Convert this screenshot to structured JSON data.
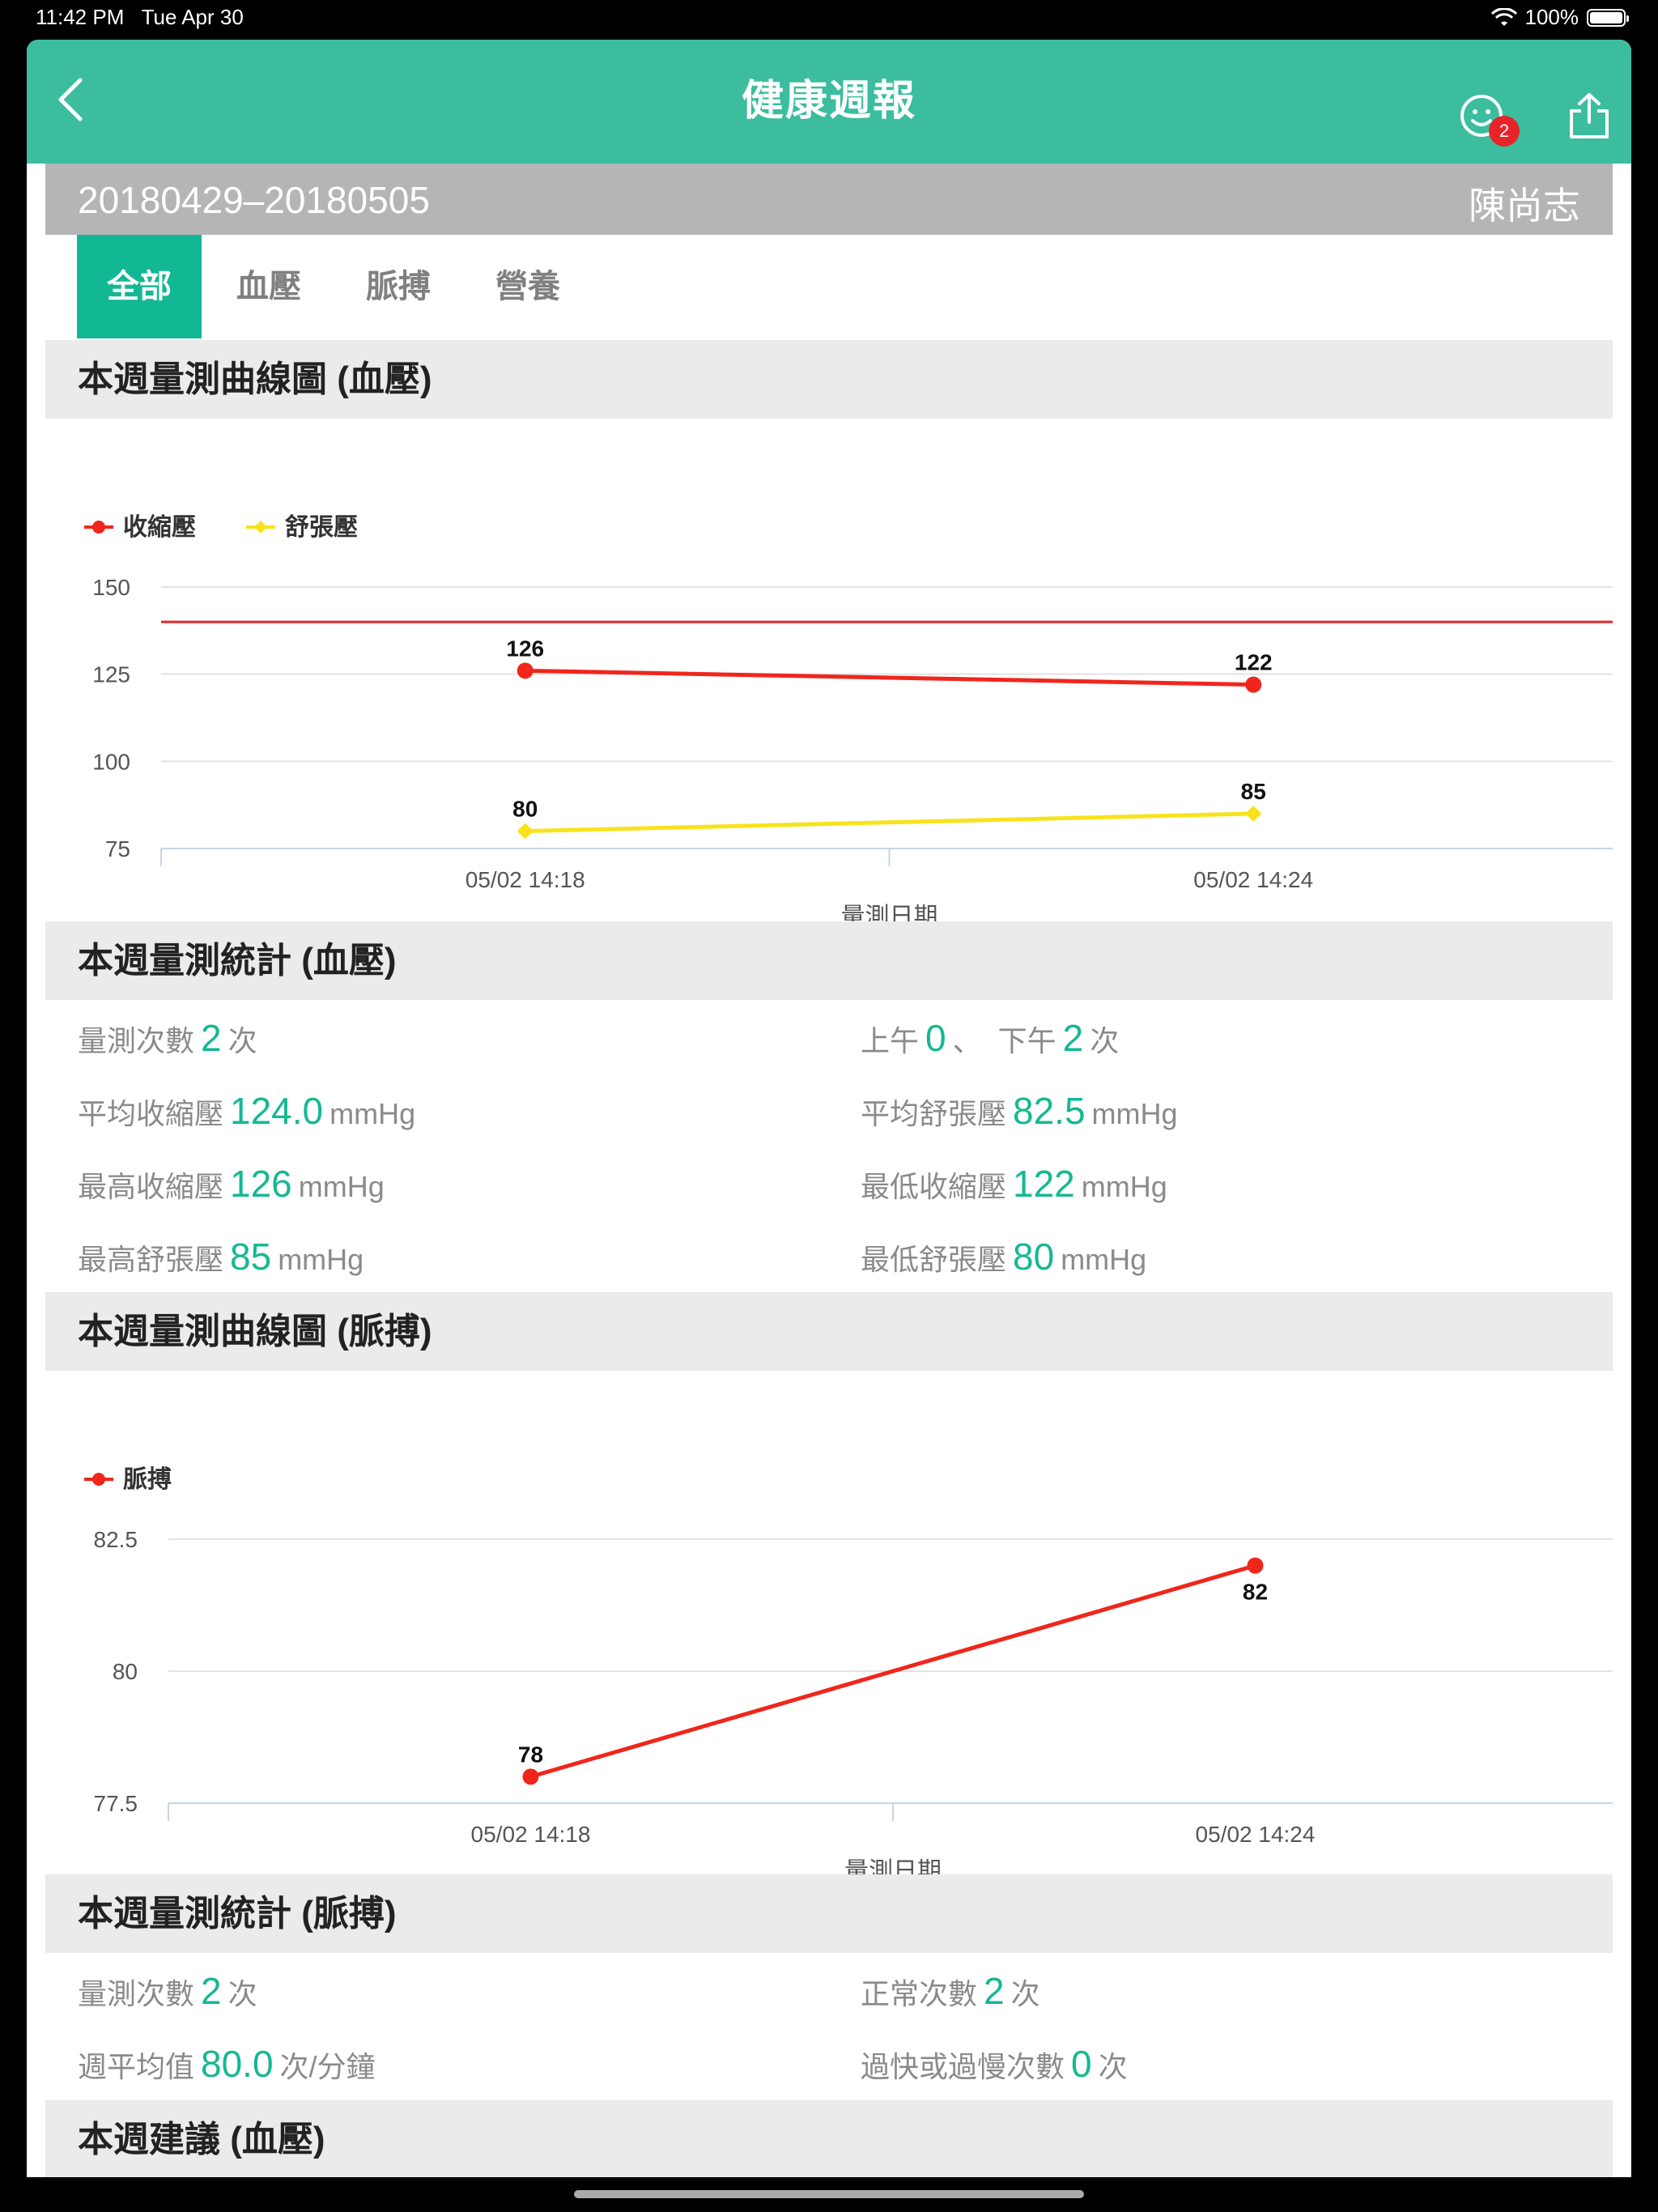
{
  "status": {
    "time": "11:42 PM",
    "date": "Tue Apr 30",
    "battery": "100%"
  },
  "nav": {
    "title": "健康週報",
    "badge_count": "2"
  },
  "report": {
    "date_range": "20180429–20180505",
    "user_name": "陳尚志"
  },
  "tabs": [
    {
      "label": "全部",
      "active": true
    },
    {
      "label": "血壓",
      "active": false
    },
    {
      "label": "脈搏",
      "active": false
    },
    {
      "label": "營養",
      "active": false
    }
  ],
  "sections": {
    "bp_chart": "本週量測曲線圖 (血壓)",
    "bp_stats": "本週量測統計 (血壓)",
    "pulse_chart": "本週量測曲線圖 (脈搏)",
    "pulse_stats": "本週量測統計 (脈搏)",
    "bp_advice": "本週建議 (血壓)"
  },
  "bp_stats": {
    "count_label": "量測次數",
    "count_value": "2",
    "count_unit": "次",
    "am_label": "上午",
    "am_value": "0",
    "sep": "、",
    "pm_label": "下午",
    "pm_value": "2",
    "pm_unit": "次",
    "avg_sys_label": "平均收縮壓",
    "avg_sys_value": "124.0",
    "avg_sys_unit": "mmHg",
    "avg_dia_label": "平均舒張壓",
    "avg_dia_value": "82.5",
    "avg_dia_unit": "mmHg",
    "max_sys_label": "最高收縮壓",
    "max_sys_value": "126",
    "max_sys_unit": "mmHg",
    "min_sys_label": "最低收縮壓",
    "min_sys_value": "122",
    "min_sys_unit": "mmHg",
    "max_dia_label": "最高舒張壓",
    "max_dia_value": "85",
    "max_dia_unit": "mmHg",
    "min_dia_label": "最低舒張壓",
    "min_dia_value": "80",
    "min_dia_unit": "mmHg"
  },
  "pulse_stats": {
    "count_label": "量測次數",
    "count_value": "2",
    "count_unit": "次",
    "normal_label": "正常次數",
    "normal_value": "2",
    "normal_unit": "次",
    "avg_label": "週平均值",
    "avg_value": "80.0",
    "avg_unit": "次/分鐘",
    "abnormal_label": "過快或過慢次數",
    "abnormal_value": "0",
    "abnormal_unit": "次"
  },
  "chart_data": [
    {
      "type": "line",
      "xlabel": "量測日期",
      "categories": [
        "05/02 14:18",
        "05/02 14:24"
      ],
      "yticks": [
        75,
        100,
        125,
        150
      ],
      "ylim": [
        75,
        150
      ],
      "reference_line": 140,
      "series": [
        {
          "name": "收縮壓",
          "values": [
            126,
            122
          ],
          "color": "#f0261c",
          "marker": "circle"
        },
        {
          "name": "舒張壓",
          "values": [
            80,
            85
          ],
          "color": "#f8e31b",
          "marker": "diamond"
        }
      ]
    },
    {
      "type": "line",
      "xlabel": "量測日期",
      "categories": [
        "05/02 14:18",
        "05/02 14:24"
      ],
      "yticks": [
        77.5,
        80,
        82.5
      ],
      "ylim": [
        77.5,
        82.5
      ],
      "series": [
        {
          "name": "脈搏",
          "values": [
            78,
            82
          ],
          "color": "#f0261c",
          "marker": "circle"
        }
      ]
    }
  ]
}
